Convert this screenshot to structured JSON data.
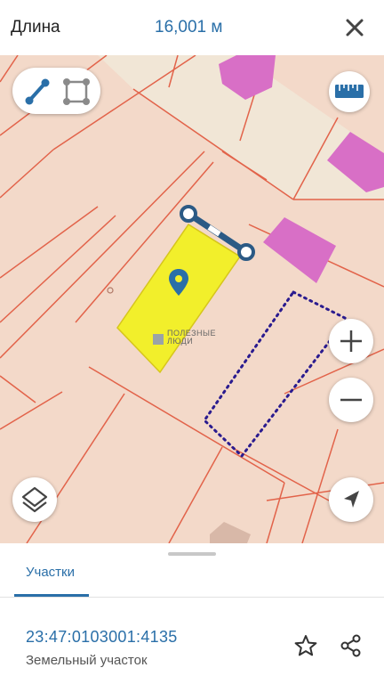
{
  "measure": {
    "label": "Длина",
    "value": "16,001 м"
  },
  "icons": {
    "close": "close-icon",
    "line_tool": "line-measure-icon",
    "area_tool": "area-measure-icon",
    "ruler": "ruler-icon",
    "zoom_in": "plus-icon",
    "zoom_out": "minus-icon",
    "layers": "layers-icon",
    "locate": "location-arrow-icon",
    "favorite": "star-icon",
    "share": "share-icon"
  },
  "map": {
    "watermark_line1": "ПОЛЕЗНЫЕ",
    "watermark_line2": "ЛЮДИ"
  },
  "sheet": {
    "tab_label": "Участки",
    "cadastral_number": "23:47:0103001:4135",
    "parcel_type": "Земельный участок"
  },
  "colors": {
    "accent": "#2a6fa8",
    "map_background": "#f3d9c9",
    "parcel_line": "#e2634a",
    "building": "#d86fc6",
    "road": "#f1e6d6",
    "selected_parcel": "#f2ef2b",
    "dotted_outline": "#2a1b8f"
  }
}
